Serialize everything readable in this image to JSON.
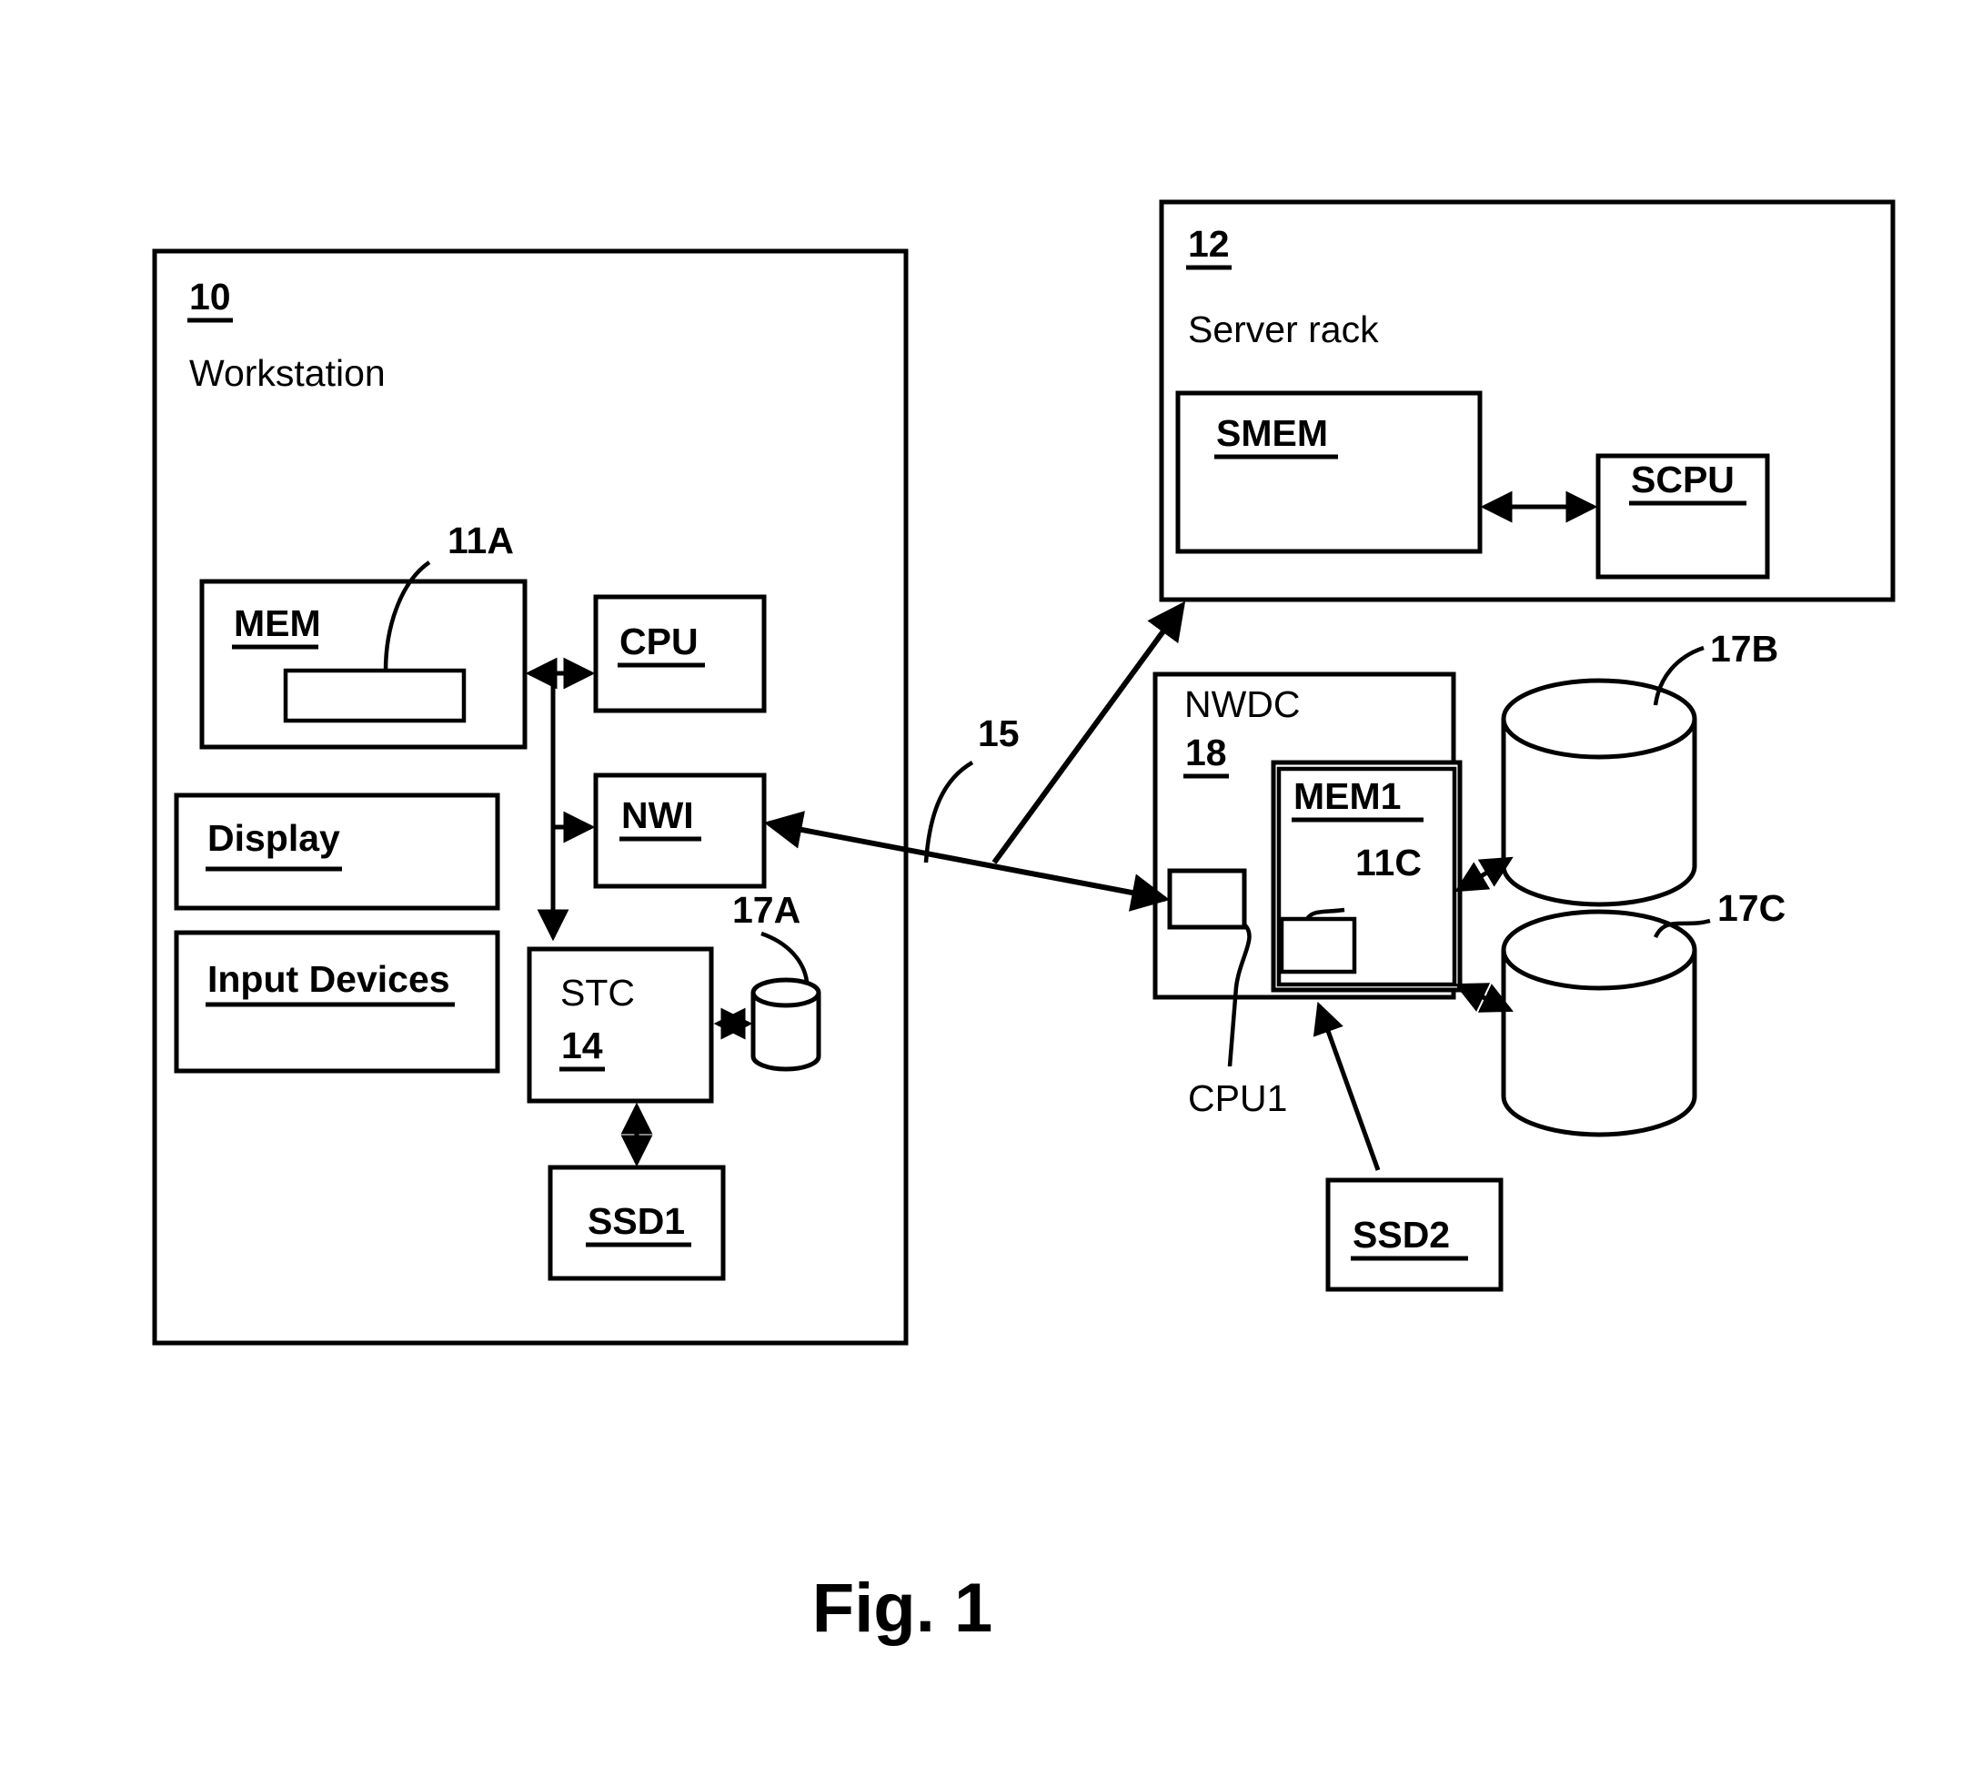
{
  "figure": {
    "caption": "Fig. 1"
  },
  "workstation": {
    "ref": "10",
    "title": "Workstation",
    "blocks": {
      "mem": {
        "label": "MEM",
        "inner_ref": "11A"
      },
      "cpu": {
        "label": "CPU"
      },
      "nwi": {
        "label": "NWI"
      },
      "display": {
        "label": "Display"
      },
      "input_devices": {
        "label": "Input Devices"
      },
      "stc": {
        "label": "STC",
        "ref": "14"
      },
      "ssd1": {
        "label": "SSD1"
      },
      "local_disk_ref": "17A"
    }
  },
  "server_rack": {
    "ref": "12",
    "title": "Server rack",
    "blocks": {
      "smem": {
        "label": "SMEM"
      },
      "scpu": {
        "label": "SCPU"
      }
    }
  },
  "network": {
    "ref": "15"
  },
  "nwdc": {
    "label": "NWDC",
    "ref": "18",
    "blocks": {
      "mem1": {
        "label": "MEM1",
        "inner_ref": "11C"
      },
      "cpu1": {
        "label": "CPU1"
      },
      "ssd2": {
        "label": "SSD2"
      }
    },
    "disks": [
      {
        "ref": "17B"
      },
      {
        "ref": "17C"
      }
    ]
  },
  "colors": {
    "stroke": "#000000",
    "background": "#ffffff"
  }
}
